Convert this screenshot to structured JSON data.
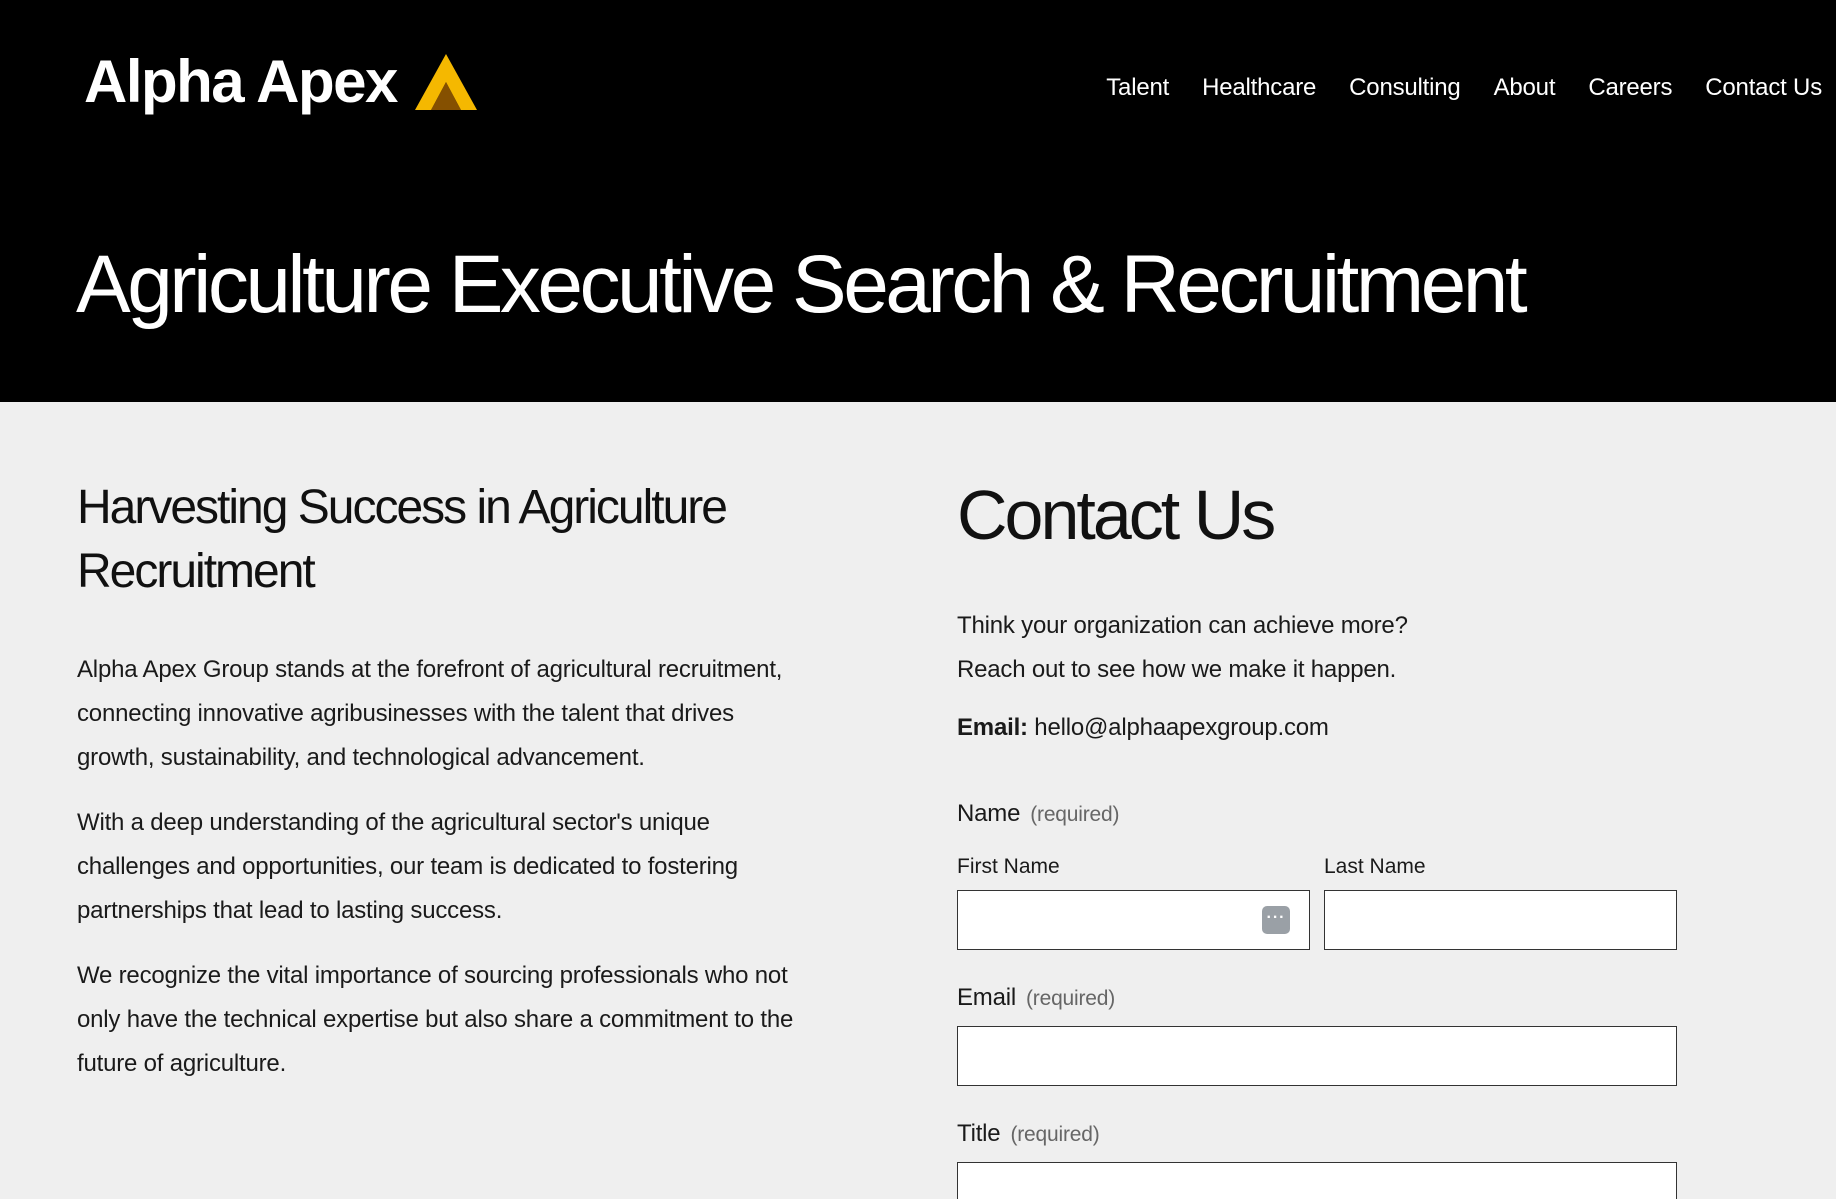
{
  "header": {
    "logo_text": "Alpha Apex",
    "nav": [
      "Talent",
      "Healthcare",
      "Consulting",
      "About",
      "Careers",
      "Contact Us"
    ],
    "title": "Agriculture Executive Search & Recruitment"
  },
  "intro_section": {
    "heading": "Harvesting Success in Agriculture Recruitment",
    "paragraphs": [
      "Alpha Apex Group stands at the forefront of agricultural recruitment, connecting innovative agribusinesses with the talent that drives growth, sustainability, and technological advancement.",
      "With a deep understanding of the agricultural sector's unique challenges and opportunities, our team is dedicated to fostering partnerships that lead to lasting success.",
      "We recognize the vital importance of sourcing professionals who not only have the technical expertise but also share a commitment to the future of agriculture."
    ]
  },
  "contact": {
    "heading": "Contact Us",
    "intro_line1": "Think your organization can achieve more?",
    "intro_line2": "Reach out to see how we make it happen.",
    "email_label": "Email:",
    "email_value": "hello@alphaapexgroup.com",
    "form": {
      "name_label": "Name",
      "required_text": "(required)",
      "first_name_label": "First Name",
      "last_name_label": "Last Name",
      "first_name_value": "",
      "last_name_value": "",
      "email_label": "Email",
      "email_value": "",
      "title_label": "Title",
      "title_value": ""
    }
  },
  "colors": {
    "hero_bg": "#000000",
    "page_bg": "#efefef",
    "logo_mark_gold": "#f5b800",
    "logo_mark_orange": "#f29100"
  },
  "icons": {
    "logo_mark": "apex-triangle-icon",
    "autofill": "autofill-dots-icon"
  }
}
